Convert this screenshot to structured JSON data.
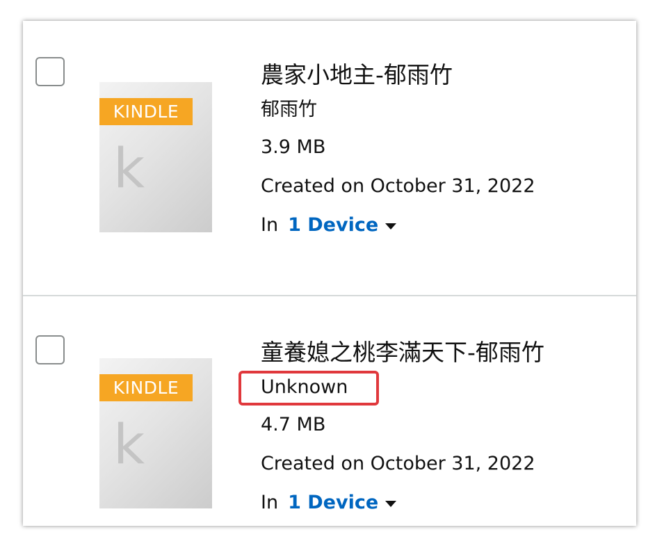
{
  "items": [
    {
      "badge": "KINDLE",
      "cover_letter": "k",
      "title": "農家小地主-郁雨竹",
      "author": "郁雨竹",
      "size": "3.9 MB",
      "created": "Created on October 31, 2022",
      "device_prefix": "In",
      "device_link": "1 Device"
    },
    {
      "badge": "KINDLE",
      "cover_letter": "k",
      "title": "童養媳之桃李滿天下-郁雨竹",
      "author": "Unknown",
      "size": "4.7 MB",
      "created": "Created on October 31, 2022",
      "device_prefix": "In",
      "device_link": "1 Device"
    }
  ],
  "colors": {
    "kindle_badge": "#f6a623",
    "link": "#0066c0",
    "highlight": "#e0383c"
  }
}
